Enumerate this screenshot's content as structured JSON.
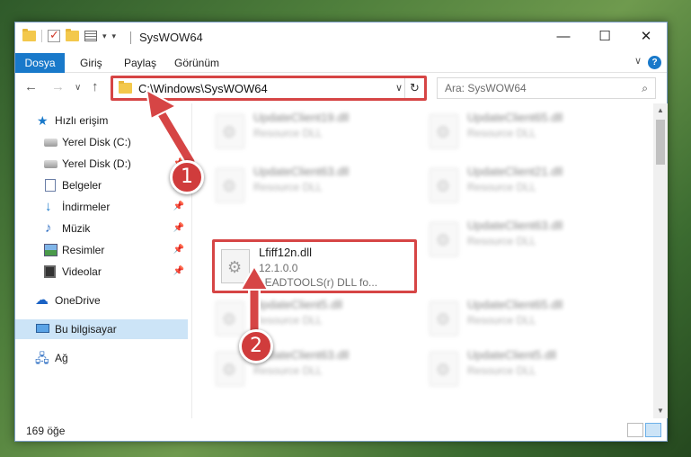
{
  "window": {
    "title": "SysWOW64",
    "controls": {
      "minimize": "—",
      "maximize": "☐",
      "close": "✕"
    }
  },
  "ribbon": {
    "tabs": [
      "Dosya",
      "Giriş",
      "Paylaş",
      "Görünüm"
    ],
    "help": "?"
  },
  "navigation": {
    "back": "←",
    "forward": "→",
    "recent": "∨",
    "up": "↑",
    "address": "C:\\Windows\\SysWOW64",
    "search_placeholder": "Ara: SysWOW64"
  },
  "sidebar": {
    "items": [
      {
        "label": "Hızlı erişim",
        "icon": "star-icon",
        "pinned": false
      },
      {
        "label": "Yerel Disk (C:)",
        "icon": "disk-icon",
        "pinned": true
      },
      {
        "label": "Yerel Disk (D:)",
        "icon": "disk-icon",
        "pinned": true
      },
      {
        "label": "Belgeler",
        "icon": "documents-icon",
        "pinned": true
      },
      {
        "label": "İndirmeler",
        "icon": "downloads-icon",
        "pinned": true
      },
      {
        "label": "Müzik",
        "icon": "music-icon",
        "pinned": true
      },
      {
        "label": "Resimler",
        "icon": "pictures-icon",
        "pinned": true
      },
      {
        "label": "Videolar",
        "icon": "videos-icon",
        "pinned": true
      },
      {
        "label": "OneDrive",
        "icon": "cloud-icon",
        "pinned": false
      },
      {
        "label": "Bu bilgisayar",
        "icon": "computer-icon",
        "pinned": false,
        "selected": true
      },
      {
        "label": "Ağ",
        "icon": "network-icon",
        "pinned": false
      }
    ]
  },
  "files": [
    {
      "name": "UpdateClient19.dll",
      "line2": "Resource DLL",
      "blurred": true
    },
    {
      "name": "UpdateClient65.dll",
      "line2": "Resource DLL",
      "blurred": true
    },
    {
      "name": "UpdateClient63.dll",
      "line2": "Resource DLL",
      "blurred": true
    },
    {
      "name": "UpdateClient21.dll",
      "line2": "Resource DLL",
      "blurred": true
    },
    {
      "name": "Lfiff12n.dll",
      "line2": "12.1.0.0",
      "line3": "LEADTOOLS(r) DLL fo...",
      "blurred": false,
      "highlighted": true
    },
    {
      "name": "UpdateClient63.dll",
      "line2": "Resource DLL",
      "blurred": true
    },
    {
      "name": "UpdateClient5.dll",
      "line2": "Resource DLL",
      "blurred": true
    },
    {
      "name": "UpdateClient65.dll",
      "line2": "Resource DLL",
      "blurred": true
    },
    {
      "name": "UpdateClient63.dll",
      "line2": "Resource DLL",
      "blurred": true
    },
    {
      "name": "UpdateClient5.dll",
      "line2": "Resource DLL",
      "blurred": true
    }
  ],
  "status": {
    "item_count": "169 öğe"
  },
  "annotations": {
    "step1": "1",
    "step2": "2",
    "color": "#d64545"
  }
}
